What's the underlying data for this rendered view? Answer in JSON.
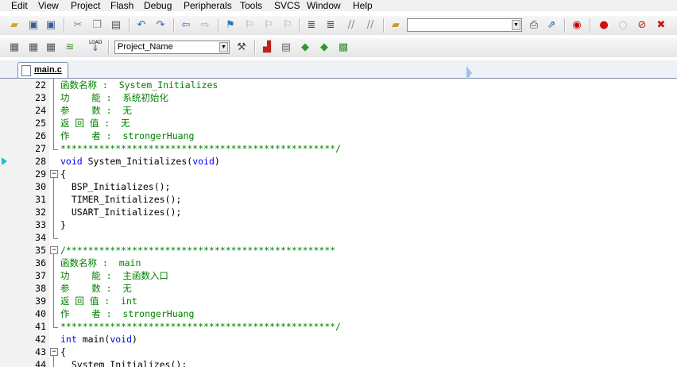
{
  "menu": [
    "Edit",
    "View",
    "Project",
    "Flash",
    "Debug",
    "Peripherals",
    "Tools",
    "SVCS",
    "Window",
    "Help"
  ],
  "toolbar": {
    "target_combo_value": "",
    "project_combo_value": "Project_Name",
    "load_label": "LOAD"
  },
  "tabs": [
    {
      "label": "main.c"
    }
  ],
  "editor": {
    "current_line": 28,
    "lines": [
      {
        "n": 22,
        "text": "函数名称 :  System_Initializes",
        "color": "green",
        "fold": "line"
      },
      {
        "n": 23,
        "text": "功    能 :  系统初始化",
        "color": "green",
        "fold": "line"
      },
      {
        "n": 24,
        "text": "参    数 :  无",
        "color": "green",
        "fold": "line"
      },
      {
        "n": 25,
        "text": "返 回 值 :  无",
        "color": "green",
        "fold": "line"
      },
      {
        "n": 26,
        "text": "作    者 :  strongerHuang",
        "color": "green",
        "fold": "line"
      },
      {
        "n": 27,
        "text": "**************************************************/",
        "color": "green",
        "fold": "end"
      },
      {
        "n": 28,
        "text": "void System_Initializes(void)",
        "color": "mixed",
        "fold": "none"
      },
      {
        "n": 29,
        "text": "{",
        "color": "black",
        "fold": "open"
      },
      {
        "n": 30,
        "text": "  BSP_Initializes();",
        "color": "black",
        "fold": "line"
      },
      {
        "n": 31,
        "text": "  TIMER_Initializes();",
        "color": "black",
        "fold": "line"
      },
      {
        "n": 32,
        "text": "  USART_Initializes();",
        "color": "black",
        "fold": "line"
      },
      {
        "n": 33,
        "text": "}",
        "color": "black",
        "fold": "line"
      },
      {
        "n": 34,
        "text": "",
        "color": "black",
        "fold": "end"
      },
      {
        "n": 35,
        "text": "/*************************************************",
        "color": "green",
        "fold": "open"
      },
      {
        "n": 36,
        "text": "函数名称 :  main",
        "color": "green",
        "fold": "line"
      },
      {
        "n": 37,
        "text": "功    能 :  主函数入口",
        "color": "green",
        "fold": "line"
      },
      {
        "n": 38,
        "text": "参    数 :  无",
        "color": "green",
        "fold": "line"
      },
      {
        "n": 39,
        "text": "返 回 值 :  int",
        "color": "green",
        "fold": "line"
      },
      {
        "n": 40,
        "text": "作    者 :  strongerHuang",
        "color": "green",
        "fold": "line"
      },
      {
        "n": 41,
        "text": "**************************************************/",
        "color": "green",
        "fold": "end"
      },
      {
        "n": 42,
        "text": "int main(void)",
        "color": "mixed",
        "fold": "none"
      },
      {
        "n": 43,
        "text": "{",
        "color": "black",
        "fold": "open"
      },
      {
        "n": 44,
        "text": "  System_Initializes();",
        "color": "black",
        "fold": "line"
      }
    ],
    "kw28": [
      "void",
      " System_Initializes(",
      "void",
      ")"
    ],
    "kw42": [
      "int",
      " main(",
      "void",
      ")"
    ]
  },
  "icons": {
    "tb1": [
      "open-folder-icon",
      "save-icon",
      "save-all-icon",
      "cut-icon",
      "copy-icon",
      "paste-icon",
      "undo-icon",
      "redo-icon",
      "back-icon",
      "forward-icon",
      "bookmark-icon",
      "prev-bookmark-icon",
      "next-bookmark-icon",
      "clear-bookmarks-icon",
      "indent-icon",
      "unindent-icon",
      "comment-icon",
      "uncomment-icon",
      "find-in-files-icon"
    ],
    "tb2": [
      "translate-icon",
      "build-icon",
      "rebuild-icon",
      "batch-build-icon",
      "load-icon",
      "target-options-icon",
      "manage-components-icon",
      "books-icon",
      "pack-installer-icon",
      "select-device-icon",
      "debug-icon"
    ]
  }
}
